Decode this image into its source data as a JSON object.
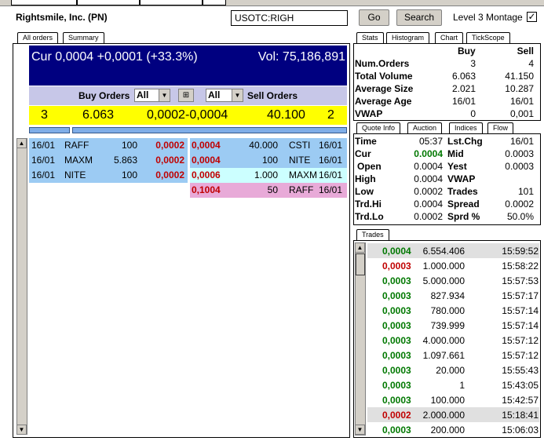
{
  "header": {
    "title": "Rightsmile, Inc. (PN)",
    "symbol": "USOTC:RIGH",
    "go_label": "Go",
    "search_label": "Search",
    "montage_label": "Level 3 Montage",
    "montage_checked": "✓"
  },
  "left_tabs": [
    "All orders",
    "Summary"
  ],
  "quote": {
    "cur": "Cur 0,0004 +0,0001 (+33.3%)",
    "vol": "Vol: 75,186,891"
  },
  "controls": {
    "buy_label": "Buy Orders",
    "sell_label": "Sell Orders",
    "buy_filter": "All",
    "sell_filter": "All",
    "link_icon": "link-icon"
  },
  "summary": {
    "buy_count": "3",
    "buy_volume": "6.063",
    "best_bid": "0,0002",
    "best_ask": "-0,0004",
    "sell_volume": "40.100",
    "sell_count": "2"
  },
  "buy_orders": [
    {
      "date": "16/01",
      "mm": "RAFF",
      "size": "100",
      "price": "0,0002"
    },
    {
      "date": "16/01",
      "mm": "MAXM",
      "size": "5.863",
      "price": "0,0002"
    },
    {
      "date": "16/01",
      "mm": "NITE",
      "size": "100",
      "price": "0,0002"
    }
  ],
  "sell_orders": [
    {
      "price": "0,0004",
      "size": "40.000",
      "mm": "CSTI",
      "date": "16/01",
      "color": "#9ccbf3"
    },
    {
      "price": "0,0004",
      "size": "100",
      "mm": "NITE",
      "date": "16/01",
      "color": "#9ccbf3"
    },
    {
      "price": "0,0006",
      "size": "1.000",
      "mm": "MAXM",
      "date": "16/01",
      "color": "#ccffff"
    },
    {
      "price": "0,1004",
      "size": "50",
      "mm": "RAFF",
      "date": "16/01",
      "color": "#e8aad8"
    }
  ],
  "stats_tabs": [
    "Stats",
    "Histogram",
    "Chart",
    "TickScope"
  ],
  "stats": {
    "col_buy": "Buy",
    "col_sell": "Sell",
    "rows": [
      {
        "label": "Num.Orders",
        "buy": "3",
        "sell": "4"
      },
      {
        "label": "Total Volume",
        "buy": "6.063",
        "sell": "41.150"
      },
      {
        "label": "Average Size",
        "buy": "2.021",
        "sell": "10.287"
      },
      {
        "label": "Average Age",
        "buy": "16/01",
        "sell": "16/01"
      },
      {
        "label": "VWAP",
        "buy": "0",
        "sell": "0,001"
      }
    ]
  },
  "quote_tabs": [
    "Quote Info",
    "Auction",
    "Indices",
    "Flow"
  ],
  "quote_info": [
    {
      "l1": "Time",
      "v1": "05:37",
      "l2": "Lst.Chg",
      "v2": "16/01",
      "g": false
    },
    {
      "l1": "Cur",
      "v1": "0.0004",
      "l2": "Mid",
      "v2": "0.0003",
      "g": true
    },
    {
      "l1": "Open",
      "v1": "0.0004",
      "l2": "Yest",
      "v2": "0.0003",
      "g": false
    },
    {
      "l1": "High",
      "v1": "0.0004",
      "l2": "VWAP",
      "v2": "",
      "g": false
    },
    {
      "l1": "Low",
      "v1": "0.0002",
      "l2": "Trades",
      "v2": "101",
      "g": false
    },
    {
      "l1": "Trd.Hi",
      "v1": "0.0004",
      "l2": "Spread",
      "v2": "0.0002",
      "g": false
    },
    {
      "l1": "Trd.Lo",
      "v1": "0.0002",
      "l2": "Sprd %",
      "v2": "50.0%",
      "g": false
    }
  ],
  "trades_tab": "Trades",
  "trades": [
    {
      "price": "0,0004",
      "size": "6.554.406",
      "time": "15:59:52",
      "c": "green",
      "hl": true
    },
    {
      "price": "0,0003",
      "size": "1.000.000",
      "time": "15:58:22",
      "c": "red",
      "hl": false
    },
    {
      "price": "0,0003",
      "size": "5.000.000",
      "time": "15:57:53",
      "c": "green",
      "hl": false
    },
    {
      "price": "0,0003",
      "size": "827.934",
      "time": "15:57:17",
      "c": "green",
      "hl": false
    },
    {
      "price": "0,0003",
      "size": "780.000",
      "time": "15:57:14",
      "c": "green",
      "hl": false
    },
    {
      "price": "0,0003",
      "size": "739.999",
      "time": "15:57:14",
      "c": "green",
      "hl": false
    },
    {
      "price": "0,0003",
      "size": "4.000.000",
      "time": "15:57:12",
      "c": "green",
      "hl": false
    },
    {
      "price": "0,0003",
      "size": "1.097.661",
      "time": "15:57:12",
      "c": "green",
      "hl": false
    },
    {
      "price": "0,0003",
      "size": "20.000",
      "time": "15:55:43",
      "c": "green",
      "hl": false
    },
    {
      "price": "0,0003",
      "size": "1",
      "time": "15:43:05",
      "c": "green",
      "hl": false
    },
    {
      "price": "0,0003",
      "size": "100.000",
      "time": "15:42:57",
      "c": "green",
      "hl": false
    },
    {
      "price": "0,0002",
      "size": "2.000.000",
      "time": "15:18:41",
      "c": "red",
      "hl": true
    },
    {
      "price": "0,0003",
      "size": "200.000",
      "time": "15:06:03",
      "c": "green",
      "hl": false
    }
  ]
}
